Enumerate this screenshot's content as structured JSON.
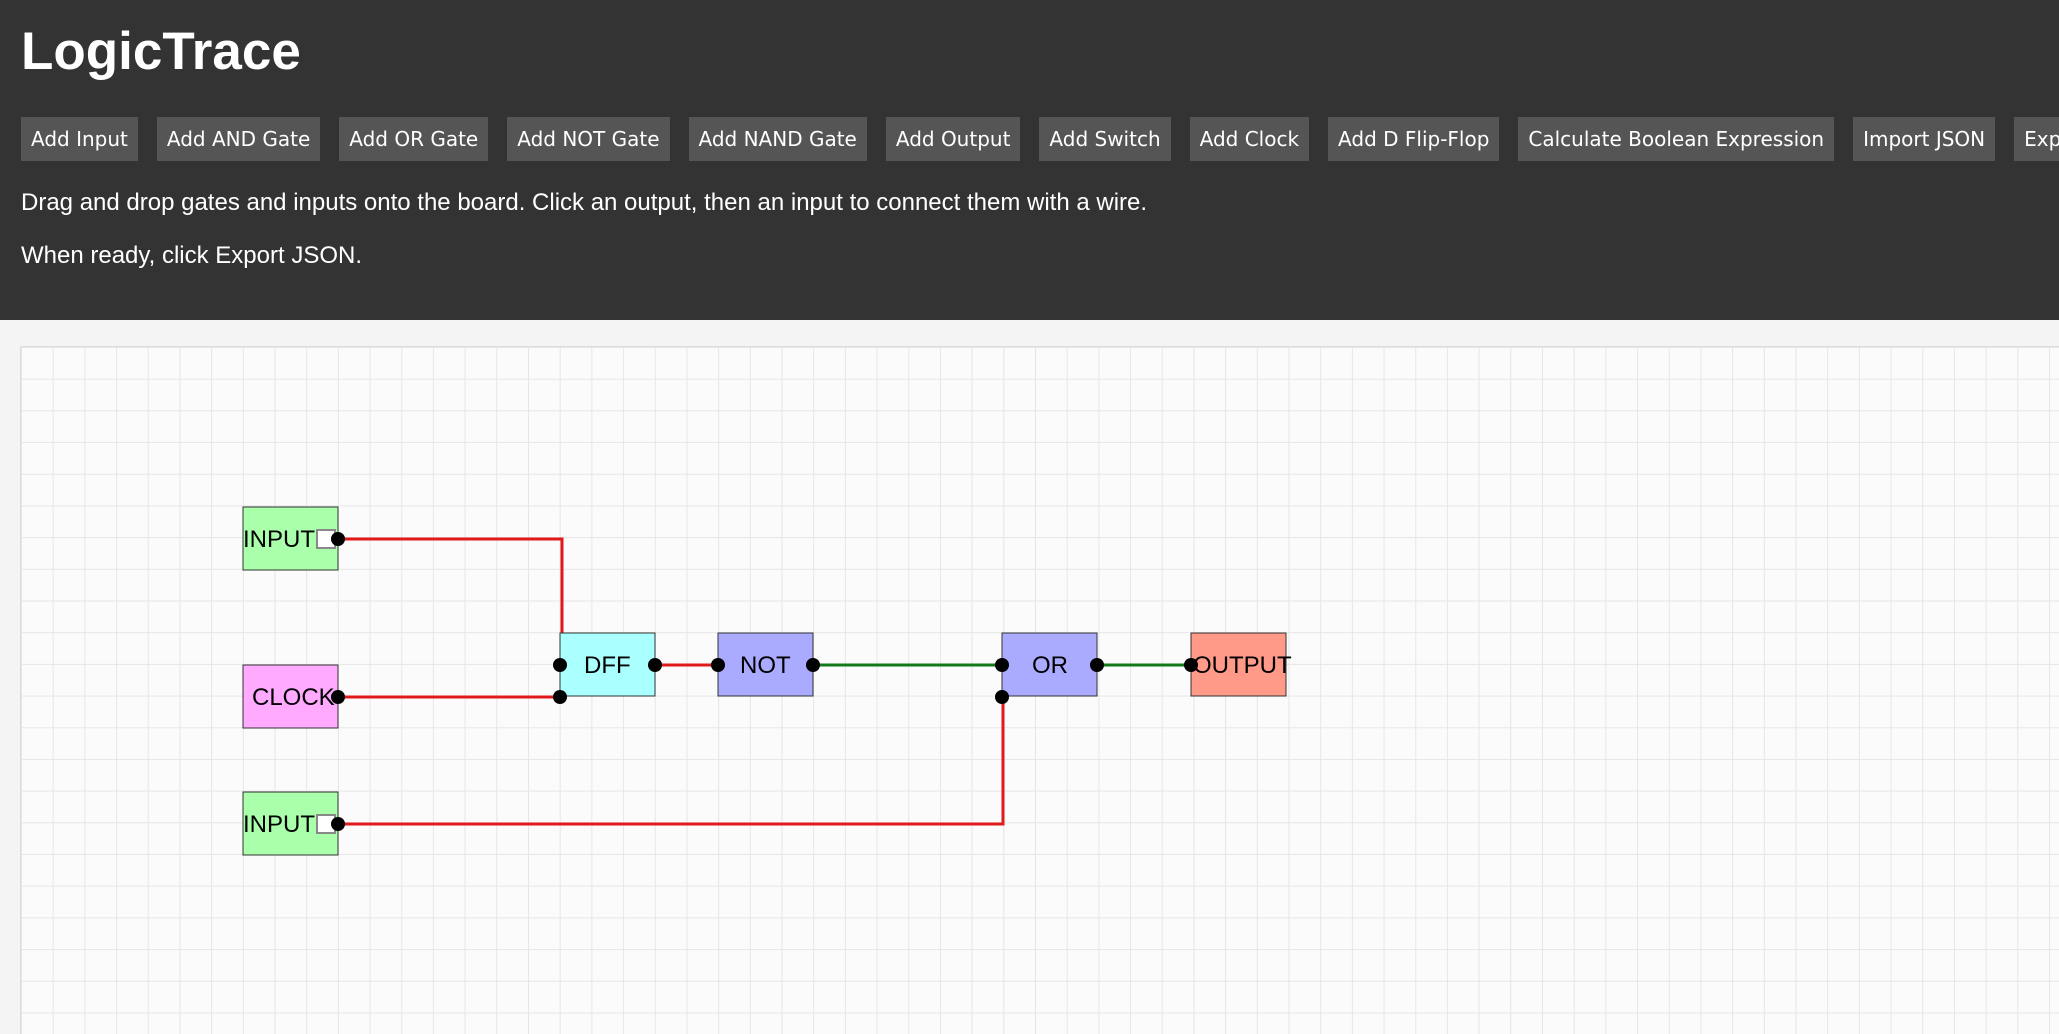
{
  "app": {
    "title": "LogicTrace"
  },
  "toolbar": {
    "buttons": [
      "Add Input",
      "Add AND Gate",
      "Add OR Gate",
      "Add NOT Gate",
      "Add NAND Gate",
      "Add Output",
      "Add Switch",
      "Add Clock",
      "Add D Flip-Flop",
      "Calculate Boolean Expression",
      "Import JSON",
      "Export JSON"
    ]
  },
  "instructions": {
    "line1": "Drag and drop gates and inputs onto the board. Click an output, then an input to connect them with a wire.",
    "line2": "When ready, click Export JSON."
  },
  "colors": {
    "input_component": "#aaffaa",
    "clock_component": "#ffaaff",
    "dff_component": "#aaffff",
    "gate_component": "#aaaaff",
    "output_component": "#ff9988",
    "wire_low": "#e0191b",
    "wire_high": "#11791b"
  },
  "board": {
    "components": {
      "input_top": {
        "label": "INPUT",
        "type": "input",
        "switch_on": false
      },
      "clock": {
        "label": "CLOCK",
        "type": "clock"
      },
      "input_bottom": {
        "label": "INPUT",
        "type": "input",
        "switch_on": false
      },
      "dff": {
        "label": "DFF",
        "type": "d-flip-flop"
      },
      "not_gate": {
        "label": "NOT",
        "type": "not"
      },
      "or_gate": {
        "label": "OR",
        "type": "or"
      },
      "output": {
        "label": "OUTPUT",
        "type": "output"
      }
    },
    "wires": [
      {
        "from": "input_top",
        "to": "dff",
        "state": "low"
      },
      {
        "from": "clock",
        "to": "dff",
        "state": "low"
      },
      {
        "from": "dff",
        "to": "not_gate",
        "state": "low"
      },
      {
        "from": "not_gate",
        "to": "or_gate",
        "state": "high"
      },
      {
        "from": "input_bottom",
        "to": "or_gate",
        "state": "low"
      },
      {
        "from": "or_gate",
        "to": "output",
        "state": "high"
      }
    ]
  }
}
